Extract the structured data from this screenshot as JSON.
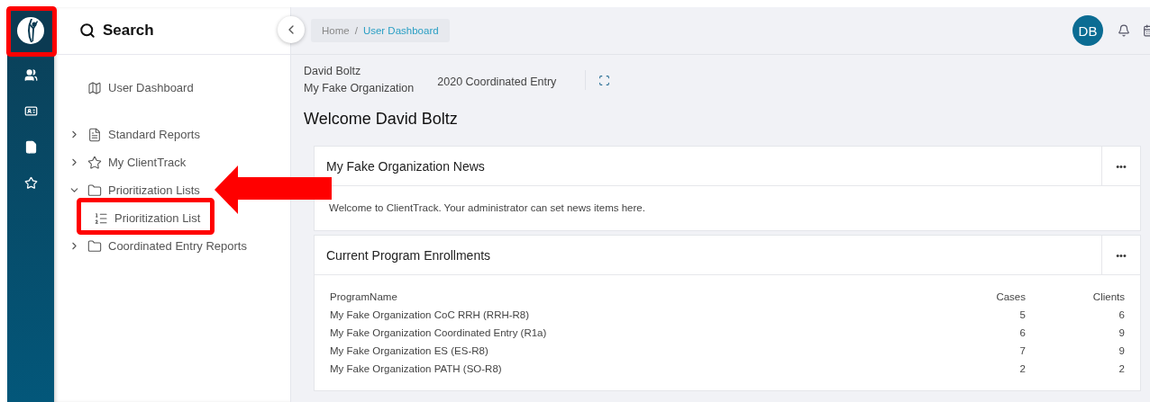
{
  "sidebar": {
    "search_label": "Search",
    "items": [
      {
        "label": "User Dashboard"
      },
      {
        "label": "Standard Reports",
        "expanded": false
      },
      {
        "label": "My ClientTrack",
        "expanded": false
      },
      {
        "label": "Prioritization Lists",
        "expanded": true,
        "children": [
          {
            "label": "Prioritization List"
          }
        ]
      },
      {
        "label": "Coordinated Entry Reports",
        "expanded": false
      }
    ]
  },
  "breadcrumb": {
    "separator": "/",
    "items": [
      "Home",
      "User Dashboard"
    ]
  },
  "user": {
    "initials": "DB",
    "name": "David Boltz",
    "organization": "My Fake Organization",
    "context": "2020 Coordinated Entry"
  },
  "welcome": "Welcome David Boltz",
  "cards": [
    {
      "title": "My Fake Organization News",
      "menu": "•••",
      "body": "Welcome to ClientTrack. Your administrator can set news items here."
    },
    {
      "title": "Current Program Enrollments",
      "menu": "•••",
      "table": {
        "columns": [
          "ProgramName",
          "Cases",
          "Clients"
        ],
        "rows": [
          [
            "My Fake Organization CoC RRH (RRH-R8)",
            "5",
            "6"
          ],
          [
            "My Fake Organization Coordinated Entry (R1a)",
            "6",
            "9"
          ],
          [
            "My Fake Organization ES (ES-R8)",
            "7",
            "9"
          ],
          [
            "My Fake Organization PATH (SO-R8)",
            "2",
            "2"
          ]
        ]
      }
    }
  ]
}
